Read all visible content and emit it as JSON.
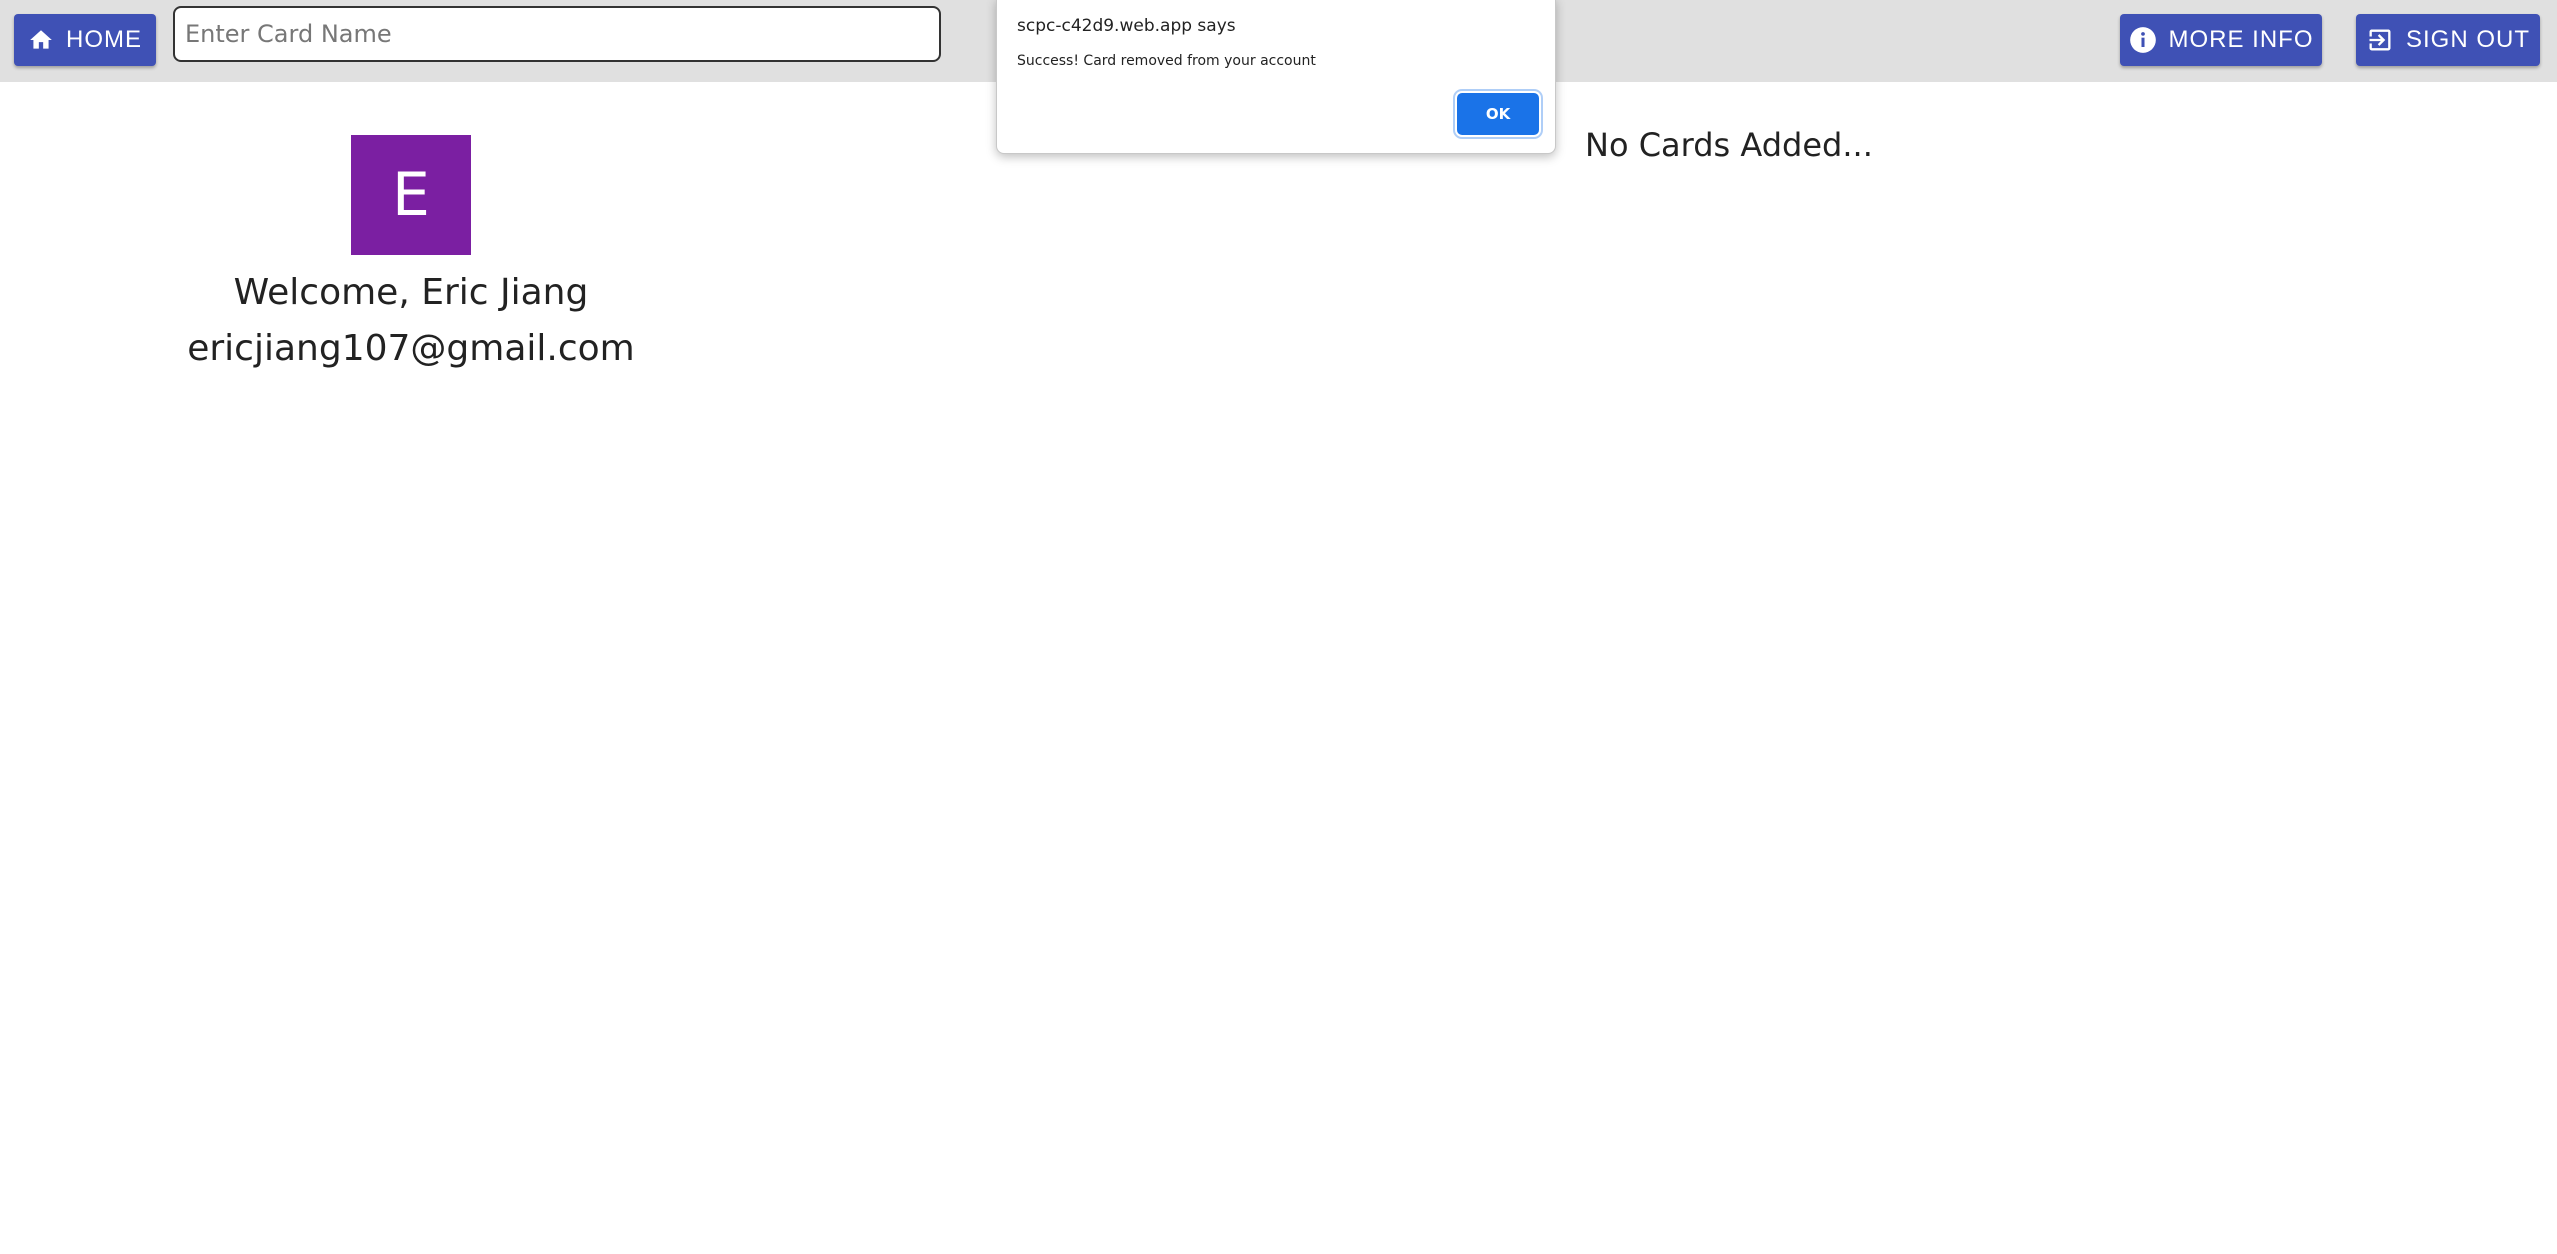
{
  "header": {
    "home_label": "HOME",
    "home_icon": "home-icon",
    "search_placeholder": "Enter Card Name",
    "search_value": "",
    "more_info_label": "MORE INFO",
    "more_info_icon": "info-icon",
    "sign_out_label": "SIGN OUT",
    "sign_out_icon": "exit-icon"
  },
  "profile": {
    "avatar_letter": "E",
    "welcome_text": "Welcome, Eric Jiang",
    "email": "ericjiang107@gmail.com"
  },
  "cards": {
    "empty_text": "No Cards Added..."
  },
  "dialog": {
    "title": "scpc-c42d9.web.app says",
    "message": "Success! Card removed from your account",
    "ok_label": "OK"
  },
  "colors": {
    "topbar": "#e0e0e0",
    "button": "#3f51b5",
    "avatar": "#7b1fa2",
    "dialog_ok": "#1a73e8"
  }
}
